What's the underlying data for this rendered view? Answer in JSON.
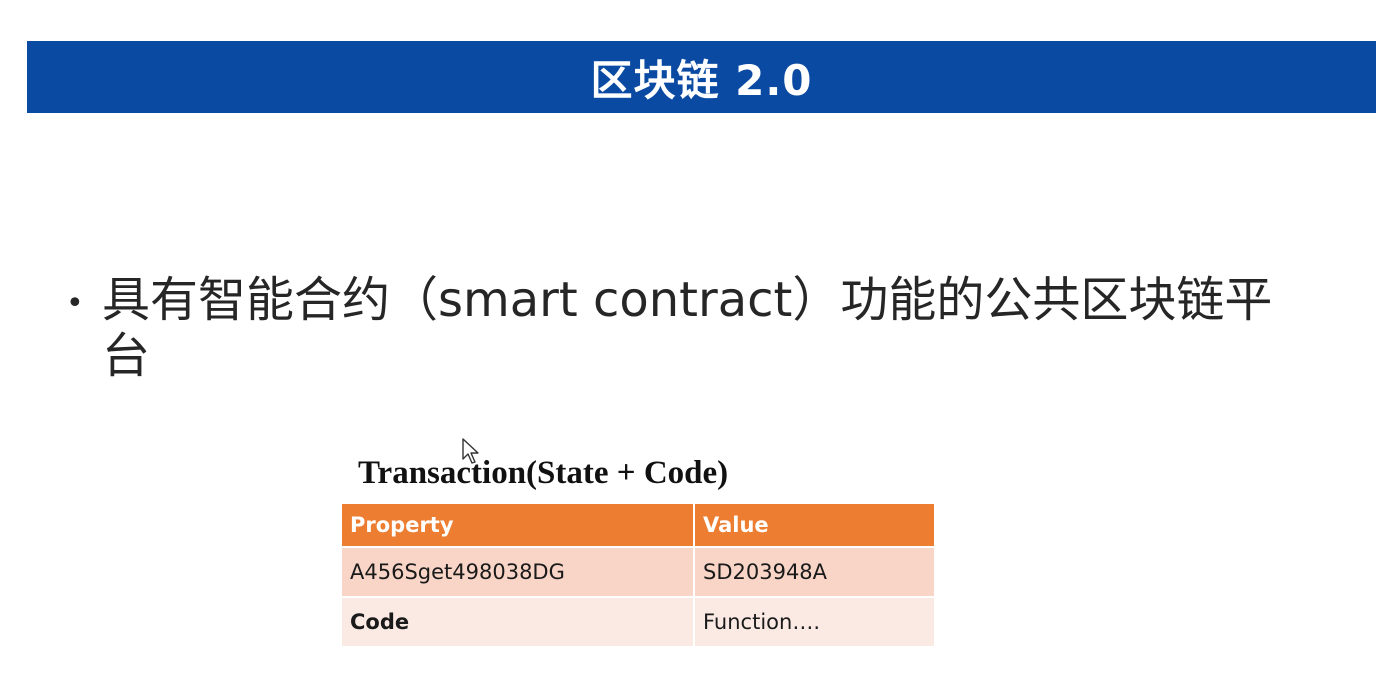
{
  "slide": {
    "title": "区块链 2.0",
    "bullet": "具有智能合约（smart contract）功能的公共区块链平台",
    "bullet_marker": "•"
  },
  "table": {
    "caption": "Transaction(State + Code)",
    "headers": [
      "Property",
      "Value"
    ],
    "rows": [
      [
        "A456Sget498038DG",
        "SD203948A"
      ],
      [
        "Code",
        "Function…."
      ]
    ]
  },
  "colors": {
    "banner": "#0b4aa2",
    "header_orange": "#ed7d31",
    "row_light": "#f8d5c7",
    "row_lighter": "#fbeae4"
  }
}
